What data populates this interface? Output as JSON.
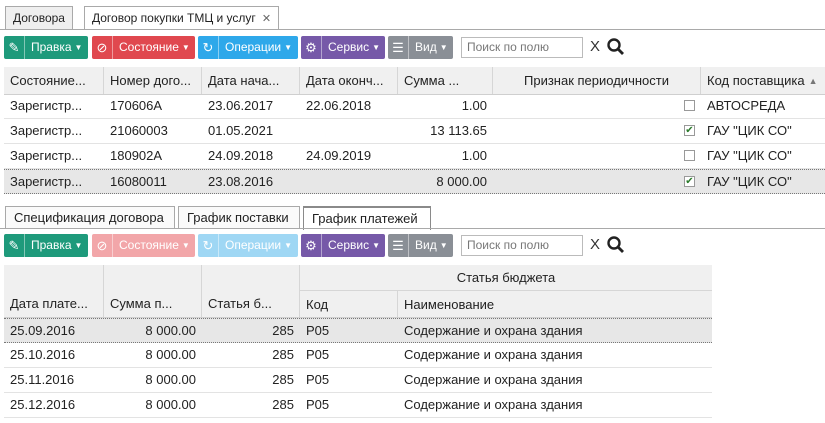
{
  "top_tabs": [
    {
      "label": "Договора",
      "active": false
    },
    {
      "label": "Договор покупки ТМЦ и услуг",
      "active": true,
      "close": "✕"
    }
  ],
  "toolbar": {
    "pravka": "Правка",
    "sostoyanie": "Состояние",
    "operacii": "Операции",
    "servis": "Сервис",
    "vid": "Вид",
    "search_placeholder": "Поиск по полю",
    "clear": "X"
  },
  "contracts": {
    "columns": [
      "Состояние...",
      "Номер дого...",
      "Дата нача...",
      "Дата оконч...",
      "Сумма ...",
      "Признак периодичности",
      "Код поставщика"
    ],
    "sort_indicator": "▲",
    "rows": [
      {
        "state": "Зарегистр...",
        "number": "170606А",
        "start": "23.06.2017",
        "end": "22.06.2018",
        "sum": "1.00",
        "periodic": false,
        "supplier": "АВТОСРЕДА"
      },
      {
        "state": "Зарегистр...",
        "number": "21060003",
        "start": "01.05.2021",
        "end": "",
        "sum": "13 113.65",
        "periodic": true,
        "supplier": "ГАУ \"ЦИК СО\""
      },
      {
        "state": "Зарегистр...",
        "number": "180902А",
        "start": "24.09.2018",
        "end": "24.09.2019",
        "sum": "1.00",
        "periodic": false,
        "supplier": "ГАУ \"ЦИК СО\""
      },
      {
        "state": "Зарегистр...",
        "number": "16080011",
        "start": "23.08.2016",
        "end": "",
        "sum": "8 000.00",
        "periodic": true,
        "supplier": "ГАУ \"ЦИК СО\"",
        "selected": true
      }
    ]
  },
  "section_tabs": [
    {
      "label": "Спецификация договора",
      "active": false
    },
    {
      "label": "График поставки",
      "active": false
    },
    {
      "label": "График платежей",
      "active": true
    }
  ],
  "payments": {
    "group_header": "Статья бюджета",
    "columns": [
      "Дата плате...",
      "Сумма п...",
      "Статья б...",
      "Код",
      "Наименование"
    ],
    "rows": [
      {
        "date": "25.09.2016",
        "sum": "8 000.00",
        "article": "285",
        "code": "Р05",
        "name": "Содержание и охрана здания",
        "selected": true
      },
      {
        "date": "25.10.2016",
        "sum": "8 000.00",
        "article": "285",
        "code": "Р05",
        "name": "Содержание и охрана здания"
      },
      {
        "date": "25.11.2016",
        "sum": "8 000.00",
        "article": "285",
        "code": "Р05",
        "name": "Содержание и охрана здания"
      },
      {
        "date": "25.12.2016",
        "sum": "8 000.00",
        "article": "285",
        "code": "Р05",
        "name": "Содержание и охрана здания"
      }
    ]
  }
}
